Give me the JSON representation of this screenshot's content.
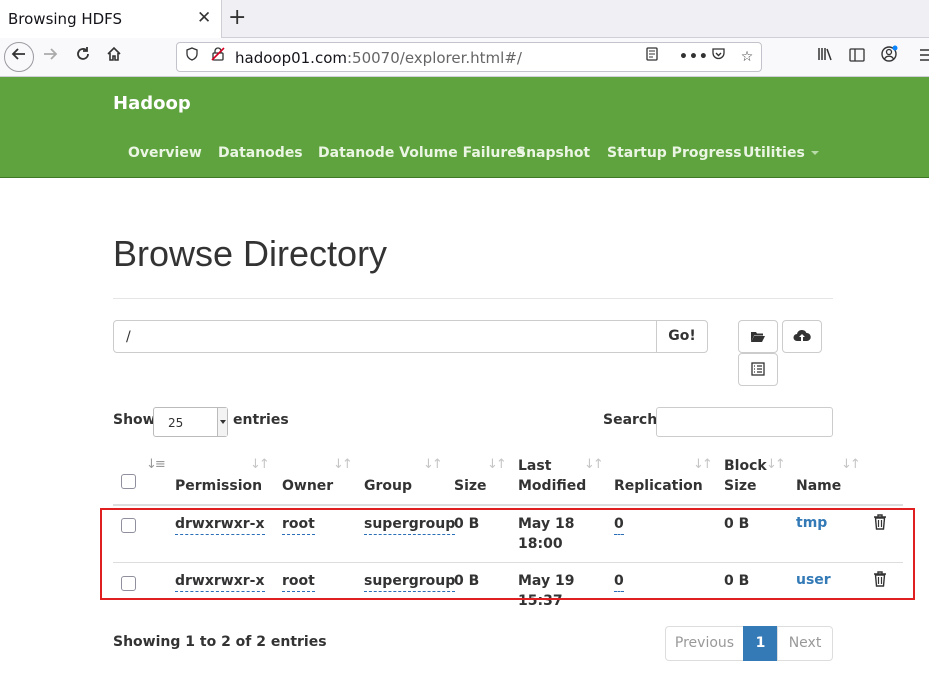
{
  "browser": {
    "tab_title": "Browsing HDFS",
    "tab_close": "✕",
    "new_tab": "+",
    "url_host": "hadoop01.com",
    "url_rest": ":50070/explorer.html#/"
  },
  "hadoop_nav": {
    "brand": "Hadoop",
    "items": [
      "Overview",
      "Datanodes",
      "Datanode Volume Failures",
      "Snapshot",
      "Startup Progress",
      "Utilities"
    ]
  },
  "page": {
    "title": "Browse Directory",
    "path_value": "/",
    "go_label": "Go!",
    "show_label": "Show",
    "page_length": "25",
    "entries_label": "entries",
    "search_label": "Search:"
  },
  "table": {
    "columns": {
      "permission": "Permission",
      "owner": "Owner",
      "group": "Group",
      "size": "Size",
      "last_modified_1": "Last",
      "last_modified_2": "Modified",
      "replication": "Replication",
      "block_size_1": "Block",
      "block_size_2": "Size",
      "name": "Name"
    },
    "rows": [
      {
        "permission": "drwxrwxr-x",
        "owner": "root",
        "group": "supergroup",
        "size": "0 B",
        "modified_1": "May 18",
        "modified_2": "18:00",
        "replication": "0",
        "block_size": "0 B",
        "name": "tmp"
      },
      {
        "permission": "drwxrwxr-x",
        "owner": "root",
        "group": "supergroup",
        "size": "0 B",
        "modified_1": "May 19",
        "modified_2": "15:37",
        "replication": "0",
        "block_size": "0 B",
        "name": "user"
      }
    ]
  },
  "footer": {
    "info": "Showing 1 to 2 of 2 entries",
    "previous": "Previous",
    "current_page": "1",
    "next": "Next"
  },
  "colors": {
    "hadoop_green": "#5fa33e",
    "link_blue": "#337ab7",
    "highlight_red": "#e02020"
  }
}
